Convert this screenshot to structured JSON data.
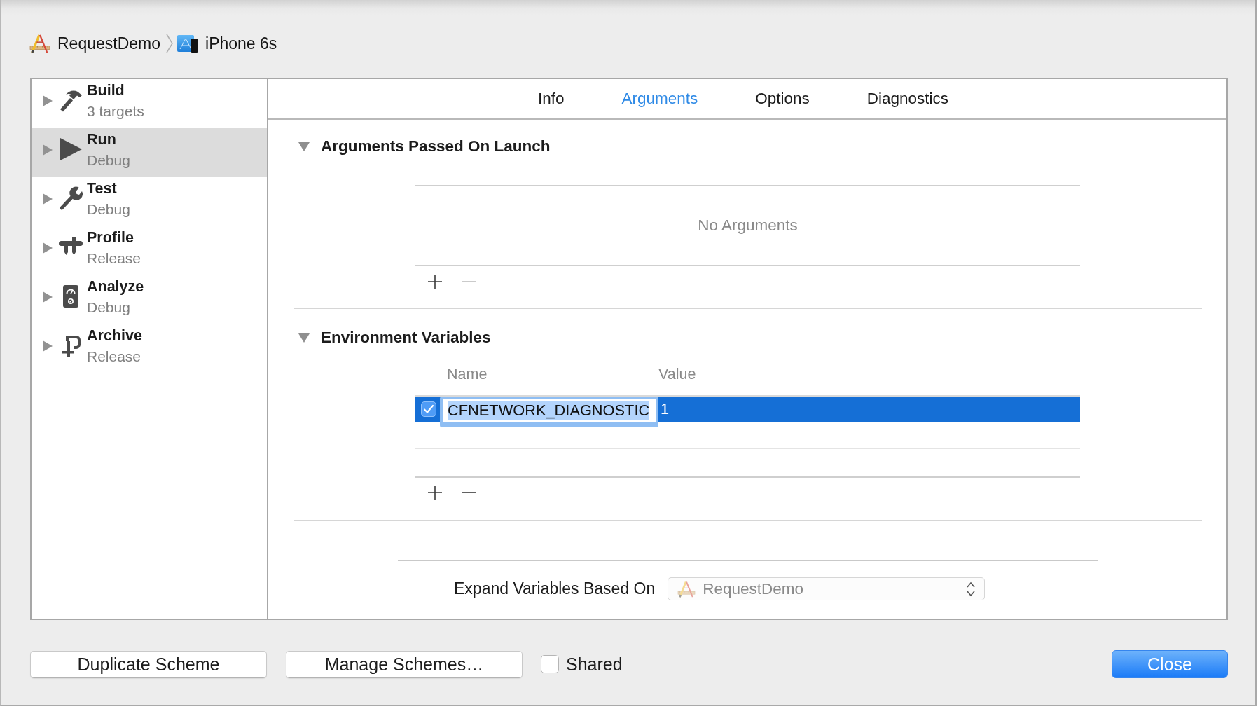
{
  "breadcrumb": [
    {
      "kind": "project",
      "label": "RequestDemo"
    },
    {
      "kind": "device",
      "label": "iPhone 6s"
    }
  ],
  "sidebar": {
    "items": [
      {
        "kind": "build",
        "title": "Build",
        "subtitle": "3 targets",
        "expanded": false,
        "selected": false
      },
      {
        "kind": "run",
        "title": "Run",
        "subtitle": "Debug",
        "expanded": false,
        "selected": true
      },
      {
        "kind": "test",
        "title": "Test",
        "subtitle": "Debug",
        "expanded": false,
        "selected": false
      },
      {
        "kind": "profile",
        "title": "Profile",
        "subtitle": "Release",
        "expanded": false,
        "selected": false
      },
      {
        "kind": "analyze",
        "title": "Analyze",
        "subtitle": "Debug",
        "expanded": false,
        "selected": false
      },
      {
        "kind": "archive",
        "title": "Archive",
        "subtitle": "Release",
        "expanded": false,
        "selected": false
      }
    ]
  },
  "tabs": [
    {
      "label": "Info",
      "selected": false
    },
    {
      "label": "Arguments",
      "selected": true
    },
    {
      "label": "Options",
      "selected": false
    },
    {
      "label": "Diagnostics",
      "selected": false
    }
  ],
  "sections": [
    {
      "kind": "list",
      "title": "Arguments Passed On Launch",
      "expanded": true,
      "empty_message": "No Arguments",
      "controls": [
        {
          "kind": "add",
          "disabled": false
        },
        {
          "kind": "remove",
          "disabled": true
        }
      ]
    },
    {
      "kind": "table",
      "title": "Environment Variables",
      "expanded": true,
      "columns": [
        "Name",
        "Value"
      ],
      "rows": [
        {
          "checked": true,
          "selected": true,
          "editing": true,
          "name": "CFNETWORK_DIAGNOSTIC",
          "value": "1"
        }
      ],
      "controls": [
        {
          "kind": "add",
          "disabled": false
        },
        {
          "kind": "remove",
          "disabled": false
        }
      ]
    }
  ],
  "expand_variables": {
    "label": "Expand Variables Based On",
    "popup": {
      "kind": "project",
      "value": "RequestDemo",
      "disabled": true
    }
  },
  "footer": {
    "buttons": [
      {
        "label": "Duplicate Scheme"
      },
      {
        "label": "Manage Schemes…"
      }
    ],
    "shared": {
      "label": "Shared",
      "checked": false
    },
    "close_button": {
      "label": "Close",
      "default": true
    }
  }
}
